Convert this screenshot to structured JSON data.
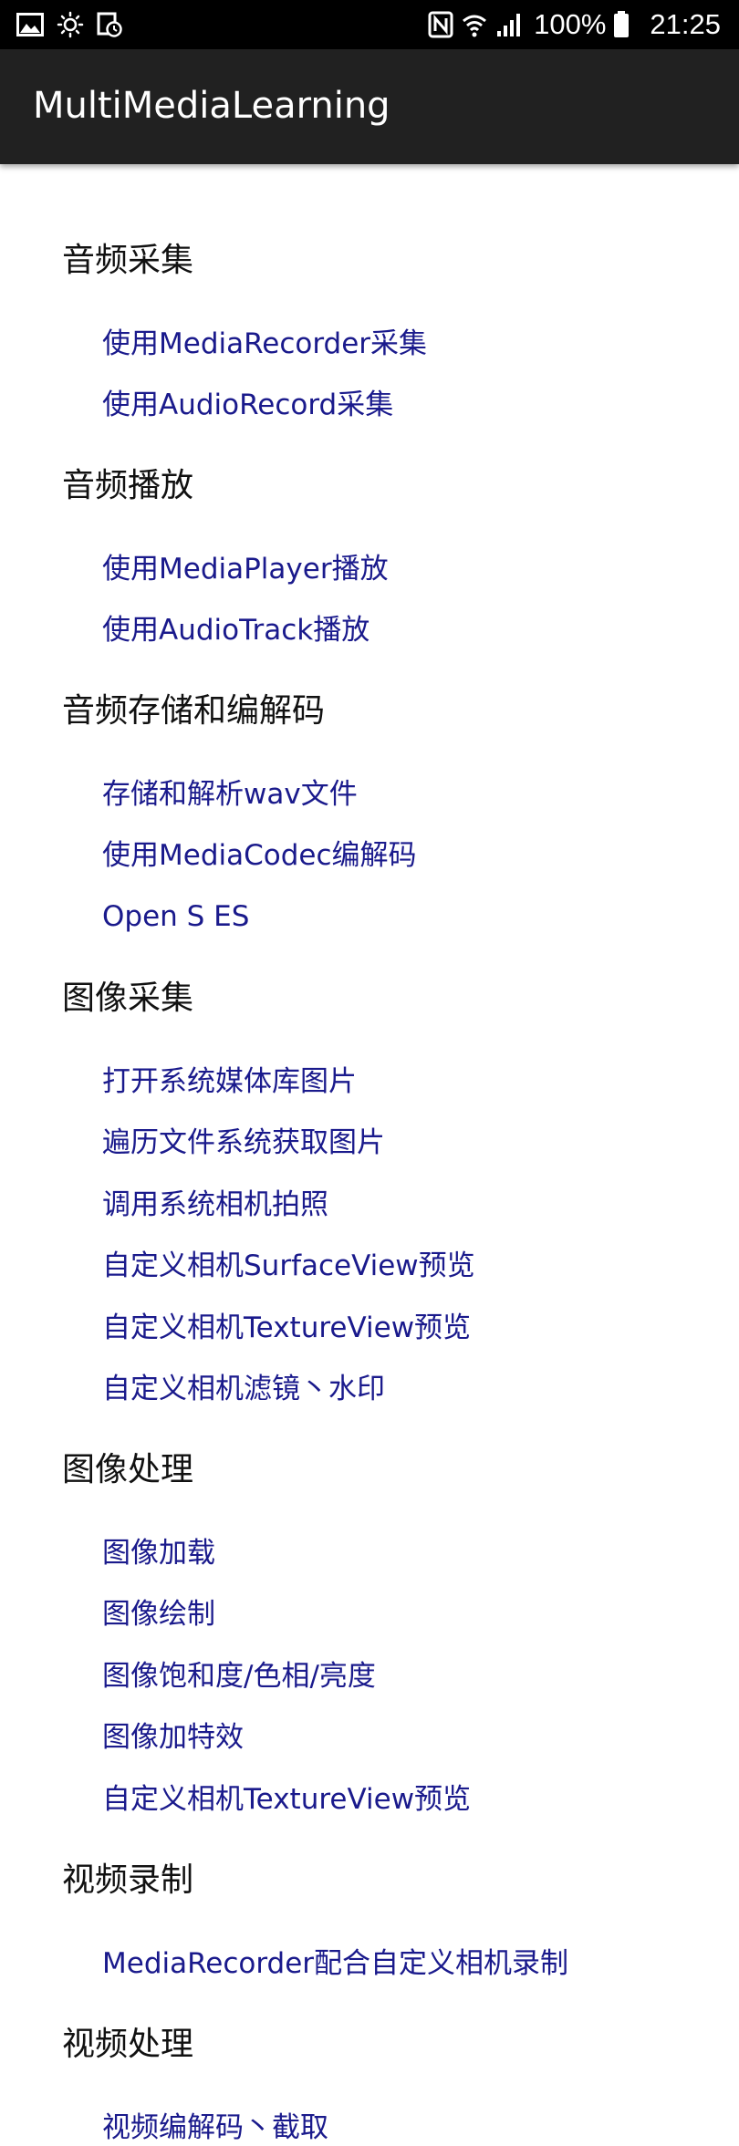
{
  "status_bar": {
    "icons_left": [
      "image-icon",
      "brightness-icon",
      "clock-icon"
    ],
    "icons_right": [
      "nfc-icon",
      "wifi-icon",
      "signal-icon"
    ],
    "battery_percent": "100%",
    "time": "21:25"
  },
  "app_bar": {
    "title": "MultiMediaLearning"
  },
  "sections": [
    {
      "title": "音频采集",
      "items": [
        "使用MediaRecorder采集",
        "使用AudioRecord采集"
      ]
    },
    {
      "title": "音频播放",
      "items": [
        "使用MediaPlayer播放",
        "使用AudioTrack播放"
      ]
    },
    {
      "title": "音频存储和编解码",
      "items": [
        "存储和解析wav文件",
        "使用MediaCodec编解码",
        "Open S ES"
      ]
    },
    {
      "title": "图像采集",
      "items": [
        "打开系统媒体库图片",
        "遍历文件系统获取图片",
        "调用系统相机拍照",
        "自定义相机SurfaceView预览",
        "自定义相机TextureView预览",
        "自定义相机滤镜丶水印"
      ]
    },
    {
      "title": "图像处理",
      "items": [
        "图像加载",
        "图像绘制",
        "图像饱和度/色相/亮度",
        "图像加特效",
        "自定义相机TextureView预览"
      ]
    },
    {
      "title": "视频录制",
      "items": [
        "MediaRecorder配合自定义相机录制"
      ]
    },
    {
      "title": "视频处理",
      "items": [
        "视频编解码丶截取"
      ]
    }
  ]
}
